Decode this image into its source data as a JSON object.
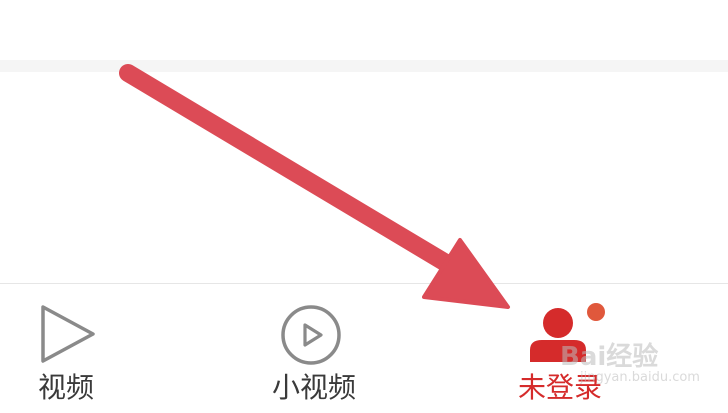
{
  "tabbar": {
    "items": [
      {
        "label": "视频",
        "icon": "play-triangle-icon",
        "active": false
      },
      {
        "label": "小视频",
        "icon": "play-circle-icon",
        "active": false
      },
      {
        "label": "未登录",
        "icon": "user-icon",
        "active": true
      }
    ],
    "colors": {
      "active": "#d52b2b",
      "inactive": "#3a3a3a",
      "icon_inactive": "#8a8a8a",
      "badge": "#e0583c"
    }
  },
  "annotation": {
    "arrow_color": "#dc4b56"
  },
  "watermark": {
    "brand": "Bai经验",
    "sub": "jingyan.baidu.com"
  }
}
